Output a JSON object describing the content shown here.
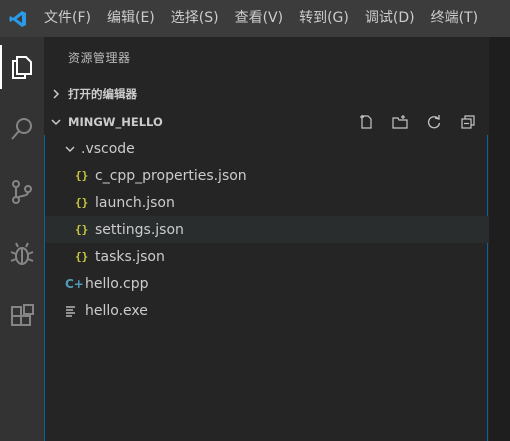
{
  "menubar": {
    "items": [
      "文件(F)",
      "编辑(E)",
      "选择(S)",
      "查看(V)",
      "转到(G)",
      "调试(D)",
      "终端(T)"
    ]
  },
  "sidebar": {
    "title": "资源管理器",
    "open_editors": {
      "label": "打开的编辑器"
    },
    "workspace": {
      "label": "MINGW_HELLO"
    },
    "tree": {
      "folder_vscode": ".vscode",
      "c_cpp_properties": "c_cpp_properties.json",
      "launch": "launch.json",
      "settings": "settings.json",
      "tasks": "tasks.json",
      "hello_cpp": "hello.cpp",
      "hello_exe": "hello.exe"
    },
    "icons": {
      "json": "{}",
      "cpp": "C+"
    }
  },
  "colors": {
    "accent": "#0e639c",
    "json_icon": "#cbcb41",
    "cpp_icon": "#519aba"
  }
}
